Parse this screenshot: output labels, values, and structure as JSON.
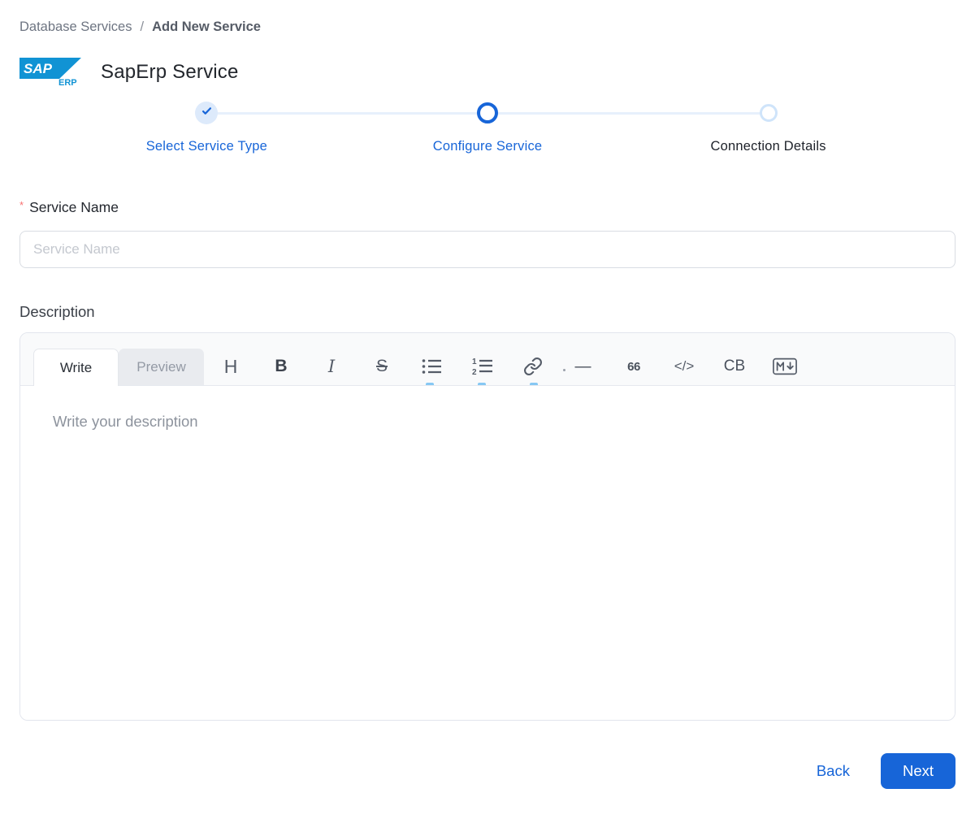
{
  "breadcrumb": {
    "parent": "Database Services",
    "separator": "/",
    "current": "Add New Service"
  },
  "header": {
    "logo_text": "SAP",
    "logo_subtext": "ERP",
    "title": "SapErp Service"
  },
  "stepper": {
    "steps": [
      {
        "label": "Select Service Type",
        "state": "completed"
      },
      {
        "label": "Configure Service",
        "state": "active"
      },
      {
        "label": "Connection Details",
        "state": "pending"
      }
    ]
  },
  "form": {
    "service_name": {
      "required_marker": "*",
      "label": "Service Name",
      "placeholder": "Service Name",
      "value": ""
    },
    "description": {
      "label": "Description",
      "placeholder": "Write your description",
      "value": ""
    }
  },
  "editor": {
    "tabs": [
      {
        "label": "Write",
        "active": true
      },
      {
        "label": "Preview",
        "active": false
      }
    ],
    "toolbar": [
      {
        "name": "heading-icon",
        "glyph": "H"
      },
      {
        "name": "bold-icon",
        "glyph": "B"
      },
      {
        "name": "italic-icon",
        "glyph": "I"
      },
      {
        "name": "strikethrough-icon",
        "glyph": "S"
      },
      {
        "name": "bullet-list-icon",
        "glyph": ""
      },
      {
        "name": "numbered-list-icon",
        "glyph": ""
      },
      {
        "name": "link-icon",
        "glyph": ""
      },
      {
        "name": "horizontal-rule-icon",
        "glyph": "—"
      },
      {
        "name": "quote-icon",
        "glyph": "66"
      },
      {
        "name": "code-icon",
        "glyph": "</>"
      },
      {
        "name": "codeblock-icon",
        "glyph": "CB"
      },
      {
        "name": "markdown-icon",
        "glyph": ""
      }
    ]
  },
  "footer": {
    "back_label": "Back",
    "next_label": "Next"
  },
  "colors": {
    "accent_blue": "#1765d8",
    "logo_blue": "#1193d4",
    "step_line": "#e7f0fc",
    "step_done_bg": "#ddeafb",
    "step_pending_ring": "#cfe4fa",
    "required_red": "#f87171"
  }
}
